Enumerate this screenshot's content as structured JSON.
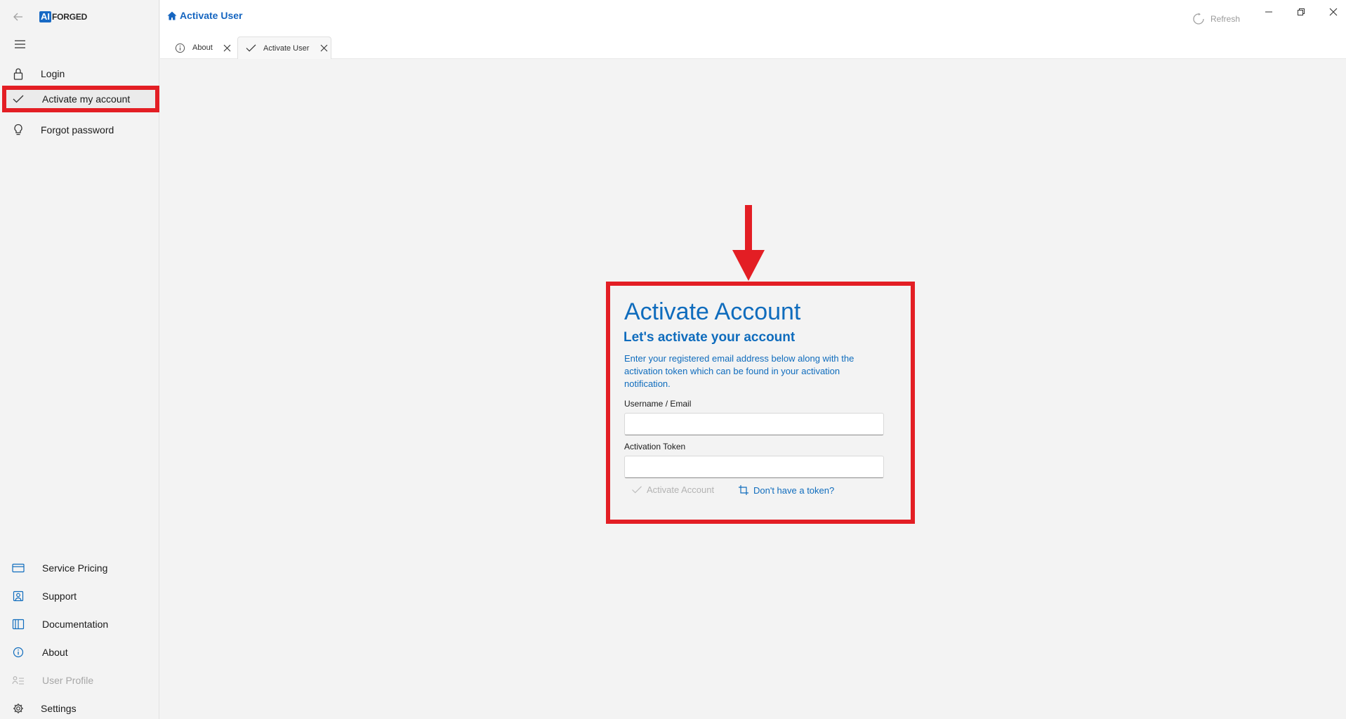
{
  "app": {
    "logo_mark": "AI",
    "logo_text": "FORGED"
  },
  "sidebar": {
    "top_items": [
      {
        "label": "Login",
        "icon": "lock-icon"
      },
      {
        "label": "Activate my account",
        "icon": "check-icon",
        "selected": true
      },
      {
        "label": "Forgot password",
        "icon": "lightbulb-icon"
      }
    ],
    "bottom_items": [
      {
        "label": "Service Pricing",
        "icon": "card-icon"
      },
      {
        "label": "Support",
        "icon": "support-icon"
      },
      {
        "label": "Documentation",
        "icon": "book-icon"
      },
      {
        "label": "About",
        "icon": "info-icon"
      },
      {
        "label": "User Profile",
        "icon": "user-list-icon",
        "disabled": true
      },
      {
        "label": "Settings",
        "icon": "gear-icon"
      }
    ]
  },
  "header": {
    "title": "Activate User",
    "refresh_label": "Refresh"
  },
  "tabs": [
    {
      "label": "About",
      "icon": "info-icon"
    },
    {
      "label": "Activate User",
      "icon": "check-icon",
      "active": true
    }
  ],
  "form": {
    "title": "Activate Account",
    "subtitle": "Let's activate your account",
    "description": "Enter your registered email address below along with the activation token which can be found in your activation notification.",
    "username_label": "Username / Email",
    "username_value": "",
    "token_label": "Activation Token",
    "token_value": "",
    "activate_button": "Activate Account",
    "no_token_link": "Don't have a token?"
  },
  "colors": {
    "accent": "#0f6cbd",
    "annotation": "#e31e24"
  }
}
